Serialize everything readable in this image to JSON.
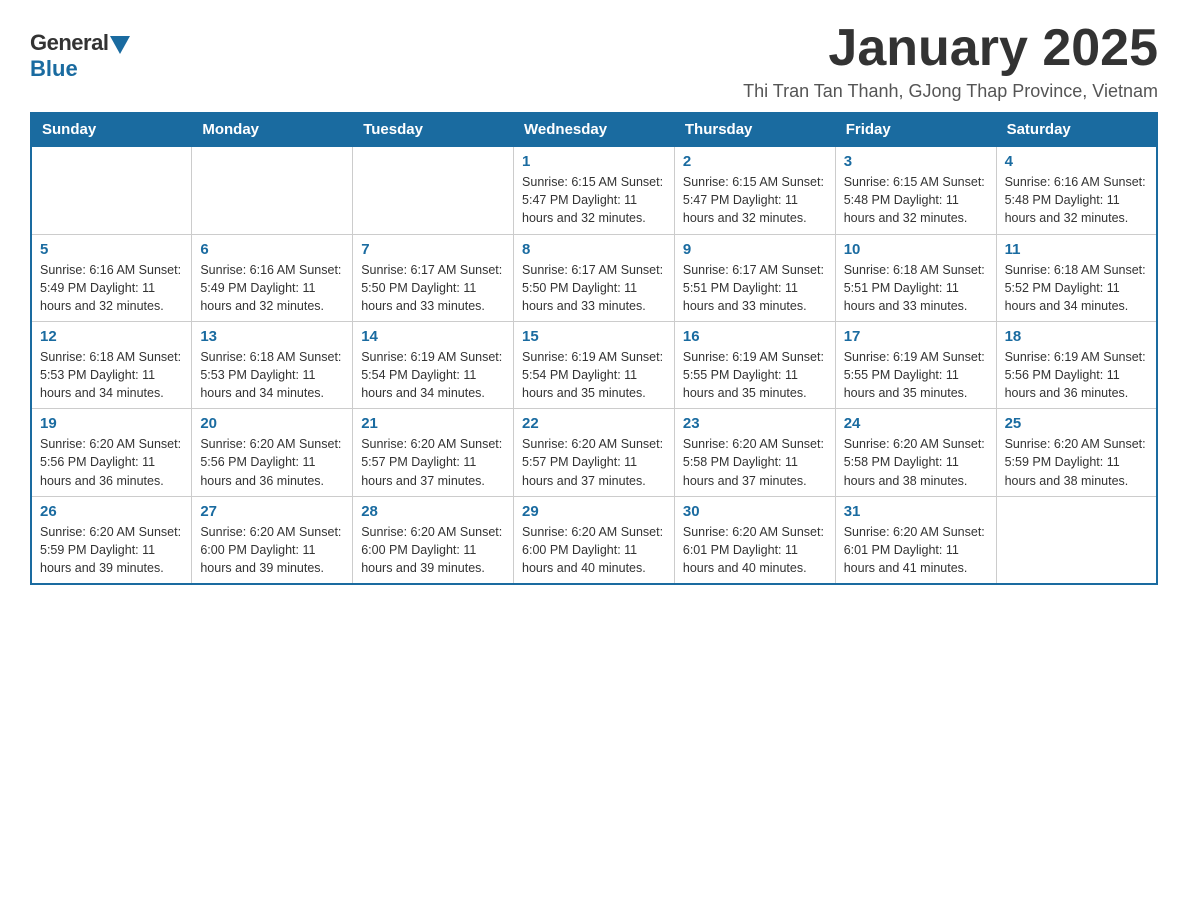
{
  "header": {
    "logo_general": "General",
    "logo_blue": "Blue",
    "main_title": "January 2025",
    "subtitle": "Thi Tran Tan Thanh, GJong Thap Province, Vietnam"
  },
  "days_of_week": [
    "Sunday",
    "Monday",
    "Tuesday",
    "Wednesday",
    "Thursday",
    "Friday",
    "Saturday"
  ],
  "weeks": [
    {
      "days": [
        {
          "number": "",
          "info": ""
        },
        {
          "number": "",
          "info": ""
        },
        {
          "number": "",
          "info": ""
        },
        {
          "number": "1",
          "info": "Sunrise: 6:15 AM\nSunset: 5:47 PM\nDaylight: 11 hours and 32 minutes."
        },
        {
          "number": "2",
          "info": "Sunrise: 6:15 AM\nSunset: 5:47 PM\nDaylight: 11 hours and 32 minutes."
        },
        {
          "number": "3",
          "info": "Sunrise: 6:15 AM\nSunset: 5:48 PM\nDaylight: 11 hours and 32 minutes."
        },
        {
          "number": "4",
          "info": "Sunrise: 6:16 AM\nSunset: 5:48 PM\nDaylight: 11 hours and 32 minutes."
        }
      ]
    },
    {
      "days": [
        {
          "number": "5",
          "info": "Sunrise: 6:16 AM\nSunset: 5:49 PM\nDaylight: 11 hours and 32 minutes."
        },
        {
          "number": "6",
          "info": "Sunrise: 6:16 AM\nSunset: 5:49 PM\nDaylight: 11 hours and 32 minutes."
        },
        {
          "number": "7",
          "info": "Sunrise: 6:17 AM\nSunset: 5:50 PM\nDaylight: 11 hours and 33 minutes."
        },
        {
          "number": "8",
          "info": "Sunrise: 6:17 AM\nSunset: 5:50 PM\nDaylight: 11 hours and 33 minutes."
        },
        {
          "number": "9",
          "info": "Sunrise: 6:17 AM\nSunset: 5:51 PM\nDaylight: 11 hours and 33 minutes."
        },
        {
          "number": "10",
          "info": "Sunrise: 6:18 AM\nSunset: 5:51 PM\nDaylight: 11 hours and 33 minutes."
        },
        {
          "number": "11",
          "info": "Sunrise: 6:18 AM\nSunset: 5:52 PM\nDaylight: 11 hours and 34 minutes."
        }
      ]
    },
    {
      "days": [
        {
          "number": "12",
          "info": "Sunrise: 6:18 AM\nSunset: 5:53 PM\nDaylight: 11 hours and 34 minutes."
        },
        {
          "number": "13",
          "info": "Sunrise: 6:18 AM\nSunset: 5:53 PM\nDaylight: 11 hours and 34 minutes."
        },
        {
          "number": "14",
          "info": "Sunrise: 6:19 AM\nSunset: 5:54 PM\nDaylight: 11 hours and 34 minutes."
        },
        {
          "number": "15",
          "info": "Sunrise: 6:19 AM\nSunset: 5:54 PM\nDaylight: 11 hours and 35 minutes."
        },
        {
          "number": "16",
          "info": "Sunrise: 6:19 AM\nSunset: 5:55 PM\nDaylight: 11 hours and 35 minutes."
        },
        {
          "number": "17",
          "info": "Sunrise: 6:19 AM\nSunset: 5:55 PM\nDaylight: 11 hours and 35 minutes."
        },
        {
          "number": "18",
          "info": "Sunrise: 6:19 AM\nSunset: 5:56 PM\nDaylight: 11 hours and 36 minutes."
        }
      ]
    },
    {
      "days": [
        {
          "number": "19",
          "info": "Sunrise: 6:20 AM\nSunset: 5:56 PM\nDaylight: 11 hours and 36 minutes."
        },
        {
          "number": "20",
          "info": "Sunrise: 6:20 AM\nSunset: 5:56 PM\nDaylight: 11 hours and 36 minutes."
        },
        {
          "number": "21",
          "info": "Sunrise: 6:20 AM\nSunset: 5:57 PM\nDaylight: 11 hours and 37 minutes."
        },
        {
          "number": "22",
          "info": "Sunrise: 6:20 AM\nSunset: 5:57 PM\nDaylight: 11 hours and 37 minutes."
        },
        {
          "number": "23",
          "info": "Sunrise: 6:20 AM\nSunset: 5:58 PM\nDaylight: 11 hours and 37 minutes."
        },
        {
          "number": "24",
          "info": "Sunrise: 6:20 AM\nSunset: 5:58 PM\nDaylight: 11 hours and 38 minutes."
        },
        {
          "number": "25",
          "info": "Sunrise: 6:20 AM\nSunset: 5:59 PM\nDaylight: 11 hours and 38 minutes."
        }
      ]
    },
    {
      "days": [
        {
          "number": "26",
          "info": "Sunrise: 6:20 AM\nSunset: 5:59 PM\nDaylight: 11 hours and 39 minutes."
        },
        {
          "number": "27",
          "info": "Sunrise: 6:20 AM\nSunset: 6:00 PM\nDaylight: 11 hours and 39 minutes."
        },
        {
          "number": "28",
          "info": "Sunrise: 6:20 AM\nSunset: 6:00 PM\nDaylight: 11 hours and 39 minutes."
        },
        {
          "number": "29",
          "info": "Sunrise: 6:20 AM\nSunset: 6:00 PM\nDaylight: 11 hours and 40 minutes."
        },
        {
          "number": "30",
          "info": "Sunrise: 6:20 AM\nSunset: 6:01 PM\nDaylight: 11 hours and 40 minutes."
        },
        {
          "number": "31",
          "info": "Sunrise: 6:20 AM\nSunset: 6:01 PM\nDaylight: 11 hours and 41 minutes."
        },
        {
          "number": "",
          "info": ""
        }
      ]
    }
  ]
}
